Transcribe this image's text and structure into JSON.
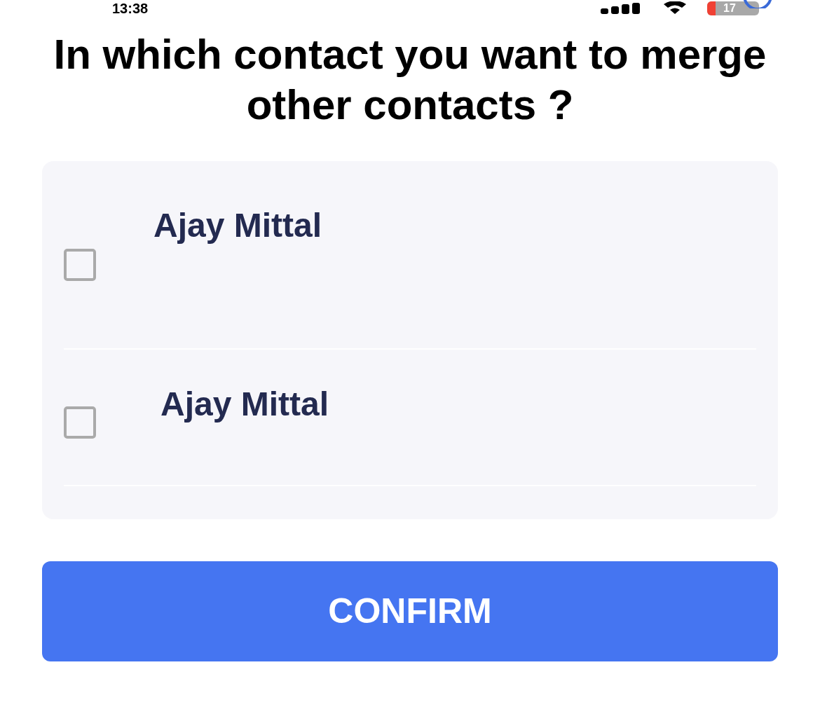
{
  "status_bar": {
    "time": "13:38",
    "battery": "17"
  },
  "title": "In which contact you want to merge other contacts ?",
  "contacts": [
    {
      "name": "Ajay Mittal",
      "checked": false
    },
    {
      "name": "Ajay Mittal",
      "checked": false
    }
  ],
  "confirm_button": {
    "label": "CONFIRM"
  }
}
